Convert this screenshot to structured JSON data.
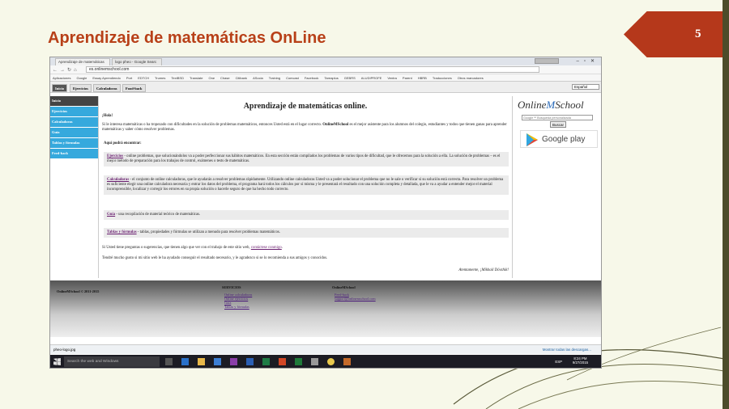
{
  "slide": {
    "title": "Aprendizaje de matemáticas OnLine",
    "number": "5"
  },
  "browser": {
    "tabs": [
      "Aprendizaje de matemáticas",
      "logo pheo - Google Searc"
    ],
    "url": "es.onlinemschool.com",
    "bookmarks": [
      "Aplicaciones",
      "Google",
      "Essay Aprendiendo",
      "Port",
      "EDTCH",
      "Trumes",
      "TextBSD",
      "Translate",
      "One",
      "Chase",
      "Citibank",
      "ASocia",
      "Training",
      "Comcast",
      "Facebook",
      "Tareaplus",
      "GEBRS",
      "ALUDIPROFE",
      "Ventra",
      "Parent",
      "HBRB",
      "Traducciones",
      "Otros marcadores"
    ]
  },
  "site": {
    "top_nav": [
      "Inicio",
      "Ejercicios",
      "Calculadoras",
      "Food-back"
    ],
    "language": "Español",
    "side_nav": [
      "Inicio",
      "Ejercicios",
      "Calculadoras",
      "Guía",
      "Tablas y fórmulas",
      "Feed-back"
    ],
    "heading": "Aprendizaje de matemáticas online.",
    "greeting": "¡Hola!",
    "intro_a": "Si le interesa matemáticas o ha tropezado con dificultades en la solución de problemas matemáticos, entonces Usted está en el lugar correcto. ",
    "intro_brand": "OnlineMSchool",
    "intro_b": " es el mejor asistente para los alumnos del colegio, estudiantes y todos que tienen ganas para aprender matemáticas y saber cómo resolver problemas.",
    "find_here": "Aquí podrá encontrar:",
    "sections": [
      {
        "link": "Ejercicios",
        "text": " - online problemas, que solucionándolos va a poder perfeccionar sus hábitos matemáticos. En esta sección están compilados los problemas de varios tipos de dificultad, que le ofrecemos para la solución a ella. La solución de problemas – es el mejor método de preparación para los trabajos de control, exámenes o tests de matemáticas."
      },
      {
        "link": "Calculadoras",
        "text": " - el conjunto de online calculadoras, que le ayudarán a resolver problemas rápidamente. Utilizando online calculadoras Usted va a poder solucionar el problema que no le sale o verificar si su solución está correcta. Para resolver un problema es suficiente elegir una online calculadora necesaria y entrar los datos del problema, el programa hará todos los cálculos por sí misma y le presentará el resultado con una solución completa y detallada, que le va a ayudar a entender mejor el material incomprensible, localizar y corregir los errores en su propia solución o hacerle seguro de que ha hecho todo correcto."
      },
      {
        "link": "Guía",
        "text": " - una recopilación de material teórico de matemáticas."
      },
      {
        "link": "Tablas y fórmulas",
        "text": " - tablas, propiedades y fórmulas se utilizan a menudo para resolver problemas matemáticos."
      }
    ],
    "contact_a": "Si Usted tiene preguntas o sugerencias, que tienen algo que ver con el trabajo de este sitio web, ",
    "contact_link": "contáctese conmigo",
    "contact_b": ".",
    "closing": "Tendré mucho gusto si mi sitio web le ha ayudado conseguir el resultado necesario, y le agradezco si se lo recomienda a sus amigos y conocidos.",
    "signature": "Atentamente, ¡Mikhail Dövzhik!",
    "logo_a": "Online",
    "logo_b": "M",
    "logo_c": "School",
    "search_placeholder": "Google™ Búsqueda personalizada",
    "search_button": "Buscar",
    "google_play": "Google play",
    "footer": {
      "copyright": "OnlineMSchool © 2011-2015",
      "services_title": "SERVICIOS",
      "services": [
        "Online calculadoras",
        "Online ejercicios",
        "Guía",
        "Tablas y fórmulas"
      ],
      "brand_title": "OnlineMSchool",
      "contacts": [
        "Feed-back",
        "support@onlinemschool.com"
      ]
    }
  },
  "download": {
    "file": "pheo-logo.jpg",
    "show_all": "Mostrar todas las descargas..."
  },
  "taskbar": {
    "search": "Search the web and Windows",
    "time": "8:24 PM",
    "date": "9/27/2015",
    "lang": "ESP"
  }
}
